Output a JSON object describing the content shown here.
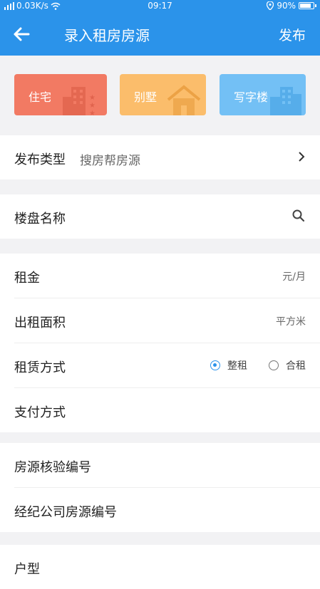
{
  "status_bar": {
    "network": "0.03K/s",
    "time": "09:17",
    "battery": "90%",
    "battery_level": 0.9
  },
  "navbar": {
    "title": "录入租房房源",
    "action": "发布"
  },
  "property_types": [
    {
      "label": "住宅",
      "icon": "building-icon",
      "color": "#f27a63"
    },
    {
      "label": "别墅",
      "icon": "house-icon",
      "color": "#fbbd6b"
    },
    {
      "label": "写字楼",
      "icon": "office-icon",
      "color": "#73c0f5"
    }
  ],
  "publish_type": {
    "label": "发布类型",
    "value": "搜房帮房源"
  },
  "estate_name": {
    "label": "楼盘名称"
  },
  "rent": {
    "label": "租金",
    "unit": "元/月"
  },
  "area": {
    "label": "出租面积",
    "unit": "平方米"
  },
  "lease_mode": {
    "label": "租赁方式",
    "options": [
      {
        "label": "整租",
        "selected": true
      },
      {
        "label": "合租",
        "selected": false
      }
    ]
  },
  "payment": {
    "label": "支付方式"
  },
  "verify_no": {
    "label": "房源核验编号"
  },
  "agency_no": {
    "label": "经纪公司房源编号"
  },
  "layout": {
    "label": "户型"
  },
  "colors": {
    "primary": "#2b93ea"
  }
}
